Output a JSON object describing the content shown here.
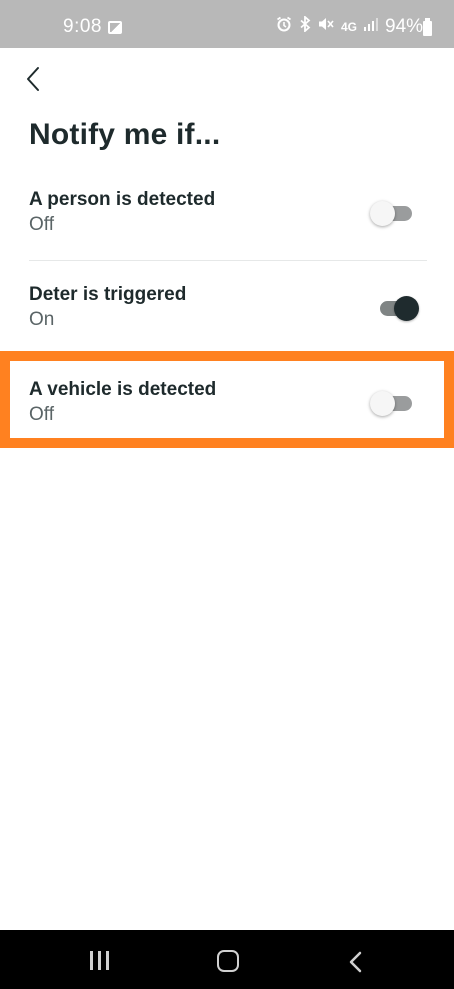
{
  "status_bar": {
    "time": "9:08",
    "battery": "94%",
    "icons": [
      "photo-icon",
      "alarm-icon",
      "bluetooth-icon",
      "mute-icon",
      "lte-icon",
      "signal-icon",
      "battery-icon"
    ],
    "network_label": "4G",
    "bg_color": "#b8b8b8"
  },
  "header": {
    "title": "Notify me if..."
  },
  "settings": [
    {
      "title": "A person is detected",
      "status": "Off",
      "enabled": false
    },
    {
      "title": "Deter is triggered",
      "status": "On",
      "enabled": true
    },
    {
      "title": "A vehicle is detected",
      "status": "Off",
      "enabled": false
    }
  ],
  "highlight": {
    "target": "A vehicle is detected",
    "color": "#ff8120"
  },
  "nav_bar": {
    "buttons": [
      "recents-icon",
      "home-icon",
      "back-icon"
    ]
  },
  "colors": {
    "text_primary": "#1e2a2c",
    "text_secondary": "#5a6466",
    "toggle_on_thumb": "#1f2b2e",
    "toggle_off_thumb": "#f6f6f6"
  }
}
